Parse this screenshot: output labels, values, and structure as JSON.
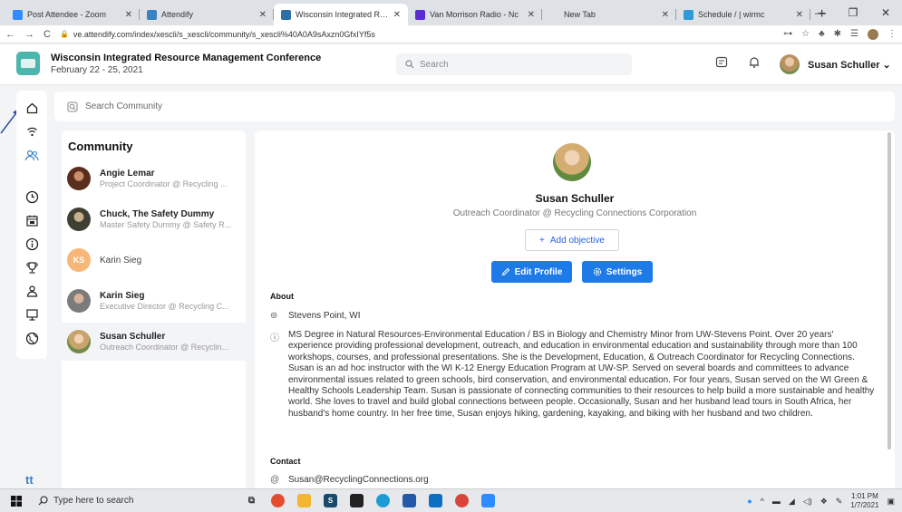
{
  "browser": {
    "tabs": [
      {
        "label": "Post Attendee - Zoom",
        "icon": "zoom",
        "color": "#2d8cff"
      },
      {
        "label": "Attendify",
        "icon": "attendify",
        "color": "#3b82c4"
      },
      {
        "label": "Wisconsin Integrated Resour",
        "icon": "page",
        "color": "#2e6fa6",
        "active": true
      },
      {
        "label": "Van Morrison Radio - Nc",
        "icon": "pandora",
        "color": "#5b2bd6"
      },
      {
        "label": "New Tab",
        "icon": "newtab",
        "color": "#dee1e6"
      },
      {
        "label": "Schedule / | wirmc",
        "icon": "schedule",
        "color": "#2e9ad6"
      }
    ],
    "url": "ve.attendify.com/index/xescli/s_xescli/community/s_xescli%40A0A9sAxzn0GfxIYf5s",
    "new_tab": "+",
    "minimize": "—",
    "maximize": "❐",
    "close": "✕"
  },
  "header": {
    "conference_title": "Wisconsin Integrated Resource Management Conference",
    "dates": "February 22 - 25, 2021",
    "search_placeholder": "Search",
    "user_name": "Susan Schuller",
    "user_menu_arrow": "⌄"
  },
  "rail": {
    "logo": "tt"
  },
  "community_search": {
    "placeholder": "Search Community"
  },
  "community": {
    "title": "Community",
    "members": [
      {
        "name": "Angie Lemar",
        "role": "Project Coordinator @ Recycling ...",
        "avatar_color": "#7a4a34"
      },
      {
        "name": "Chuck, The Safety Dummy",
        "role": "Master Safety Dummy @ Safety R...",
        "avatar_color": "#4a4a3a"
      },
      {
        "name": "Karin Sieg",
        "role": "",
        "initials": "KS",
        "avatar_color": "#f6b779"
      },
      {
        "name": "Karin Sieg",
        "role": "Executive Director @ Recycling C...",
        "avatar_color": "#8a8a8a"
      },
      {
        "name": "Susan Schuller",
        "role": "Outreach Coordinator @ Recyclin...",
        "avatar_color": "#c9a36d",
        "active": true
      }
    ]
  },
  "profile": {
    "name": "Susan Schuller",
    "role": "Outreach Coordinator @ Recycling Connections Corporation",
    "add_objective": "Add objective",
    "edit_profile": "Edit Profile",
    "settings": "Settings",
    "about_label": "About",
    "location": "Stevens Point, WI",
    "bio": "MS Degree in Natural Resources-Environmental Education / BS in Biology and Chemistry Minor from UW-Stevens Point. Over 20 years' experience providing professional development, outreach, and education in environmental education and sustainability through more than 100 workshops, courses, and professional presentations. She is the Development, Education, & Outreach Coordinator for Recycling Connections. Susan is an ad hoc instructor with the WI K-12 Energy Education Program at UW-SP. Served on several boards and committees to advance environmental issues related to green schools, bird conservation, and environmental education. For four years, Susan served on the WI Green & Healthy Schools Leadership Team. Susan is passionate of connecting communities to their resources to help build a more sustainable and healthy world. She loves to travel and build global connections between people. Occasionally, Susan and her husband lead tours in South Africa, her husband's home country. In her free time, Susan enjoys hiking, gardening, kayaking, and biking with her husband and two children.",
    "contact_label": "Contact",
    "email": "Susan@RecyclingConnections.org"
  },
  "taskbar": {
    "search_placeholder": "Type here to search",
    "time": "1:01 PM",
    "date": "1/7/2021"
  }
}
